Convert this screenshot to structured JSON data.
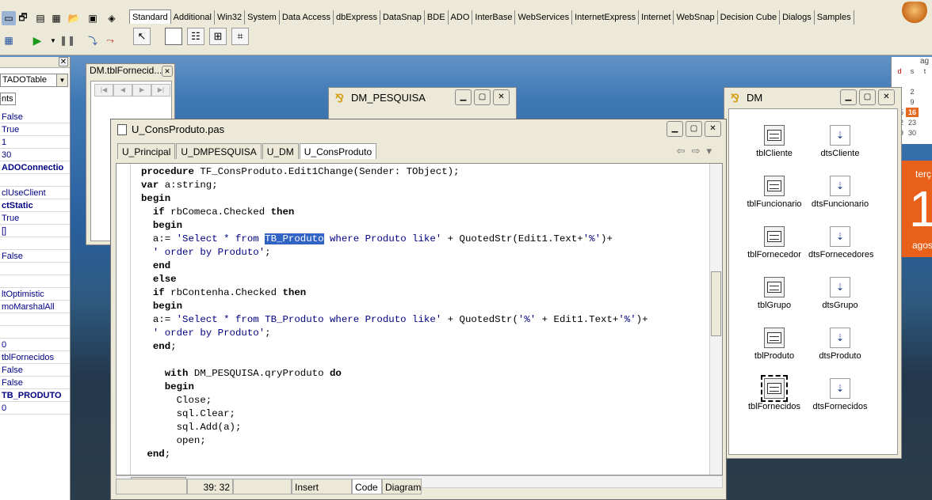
{
  "palette": {
    "tabs": [
      "Standard",
      "Additional",
      "Win32",
      "System",
      "Data Access",
      "dbExpress",
      "DataSnap",
      "BDE",
      "ADO",
      "InterBase",
      "WebServices",
      "InternetExpress",
      "Internet",
      "WebSnap",
      "Decision Cube",
      "Dialogs",
      "Samples"
    ],
    "active_tab": "Standard"
  },
  "inspector": {
    "combo_value": "TADOTable",
    "tab_label": "nts",
    "rows": [
      {
        "text": "False",
        "bold": false
      },
      {
        "text": "True",
        "bold": false
      },
      {
        "text": "1",
        "bold": false
      },
      {
        "text": "30",
        "bold": false
      },
      {
        "text": "ADOConnectio",
        "bold": true
      },
      {
        "text": "",
        "bold": false
      },
      {
        "text": "clUseClient",
        "bold": false
      },
      {
        "text": "ctStatic",
        "bold": true
      },
      {
        "text": "True",
        "bold": false
      },
      {
        "text": "[]",
        "bold": false
      },
      {
        "text": "",
        "bold": false
      },
      {
        "text": "False",
        "bold": false
      },
      {
        "text": "",
        "bold": false
      },
      {
        "text": "",
        "bold": false
      },
      {
        "text": "ltOptimistic",
        "bold": false
      },
      {
        "text": "moMarshalAll",
        "bold": false
      },
      {
        "text": "",
        "bold": false
      },
      {
        "text": "",
        "bold": false
      },
      {
        "text": "0",
        "bold": false
      },
      {
        "text": "tblFornecidos",
        "bold": false
      },
      {
        "text": "False",
        "bold": false
      },
      {
        "text": "False",
        "bold": false
      },
      {
        "text": "TB_PRODUTO",
        "bold": true
      },
      {
        "text": "0",
        "bold": false
      }
    ]
  },
  "calendar": {
    "header": "ag",
    "days": [
      {
        "d": "d",
        "type": "red"
      },
      {
        "d": "s",
        "type": ""
      },
      {
        "d": "t",
        "type": ""
      },
      {
        "d": "",
        "type": ""
      },
      {
        "d": "",
        "type": ""
      },
      {
        "d": "",
        "type": ""
      },
      {
        "d": "1",
        "type": ""
      },
      {
        "d": "2",
        "type": ""
      },
      {
        "d": "",
        "type": ""
      },
      {
        "d": "8",
        "type": ""
      },
      {
        "d": "9",
        "type": ""
      },
      {
        "d": "",
        "type": ""
      },
      {
        "d": "15",
        "type": ""
      },
      {
        "d": "16",
        "type": "today"
      },
      {
        "d": "",
        "type": ""
      },
      {
        "d": "22",
        "type": ""
      },
      {
        "d": "23",
        "type": ""
      },
      {
        "d": "",
        "type": ""
      },
      {
        "d": "29",
        "type": ""
      },
      {
        "d": "30",
        "type": ""
      },
      {
        "d": "",
        "type": ""
      }
    ],
    "clock_day": "terç",
    "clock_num": "1",
    "clock_month": "agos"
  },
  "fornecid_window": {
    "title": "DM.tblFornecid..."
  },
  "pesquisa_window": {
    "title": "DM_PESQUISA"
  },
  "dm_window": {
    "title": "DM",
    "components": [
      {
        "label": "tblCliente",
        "kind": "table"
      },
      {
        "label": "dtsCliente",
        "kind": "datasource"
      },
      {
        "label": "tblFuncionario",
        "kind": "table"
      },
      {
        "label": "dtsFuncionario",
        "kind": "datasource"
      },
      {
        "label": "tblFornecedor",
        "kind": "table"
      },
      {
        "label": "dtsFornecedores",
        "kind": "datasource"
      },
      {
        "label": "tblGrupo",
        "kind": "table"
      },
      {
        "label": "dtsGrupo",
        "kind": "datasource"
      },
      {
        "label": "tblProduto",
        "kind": "table"
      },
      {
        "label": "dtsProduto",
        "kind": "datasource"
      },
      {
        "label": "tblFornecidos",
        "kind": "table",
        "selected": true
      },
      {
        "label": "dtsFornecidos",
        "kind": "datasource"
      }
    ]
  },
  "editor": {
    "title": "U_ConsProduto.pas",
    "tabs": [
      "U_Principal",
      "U_DMPESQUISA",
      "U_DM",
      "U_ConsProduto"
    ],
    "active_tab": "U_ConsProduto",
    "status_position": "39:  32",
    "status_mode": "Insert",
    "bottom_tabs": [
      "Code",
      "Diagram"
    ],
    "code_lines": [
      "procedure TF_ConsProduto.Edit1Change(Sender: TObject);",
      "var a:string;",
      "begin",
      "  if rbComeca.Checked then",
      "  begin",
      "  a:= 'Select * from TB_Produto where Produto like' + QuotedStr(Edit1.Text+'%')+",
      "  ' order by Produto';",
      "  end",
      "  else",
      "  if rbContenha.Checked then",
      "  begin",
      "  a:= 'Select * from TB_Produto where Produto like' + QuotedStr('%' + Edit1.Text+'%')+",
      "  ' order by Produto';",
      "  end;",
      "",
      "    with DM_PESQUISA.qryProduto do",
      "    begin",
      "      Close;",
      "      sql.Clear;",
      "      sql.Add(a);",
      "      open;",
      " end;"
    ]
  }
}
